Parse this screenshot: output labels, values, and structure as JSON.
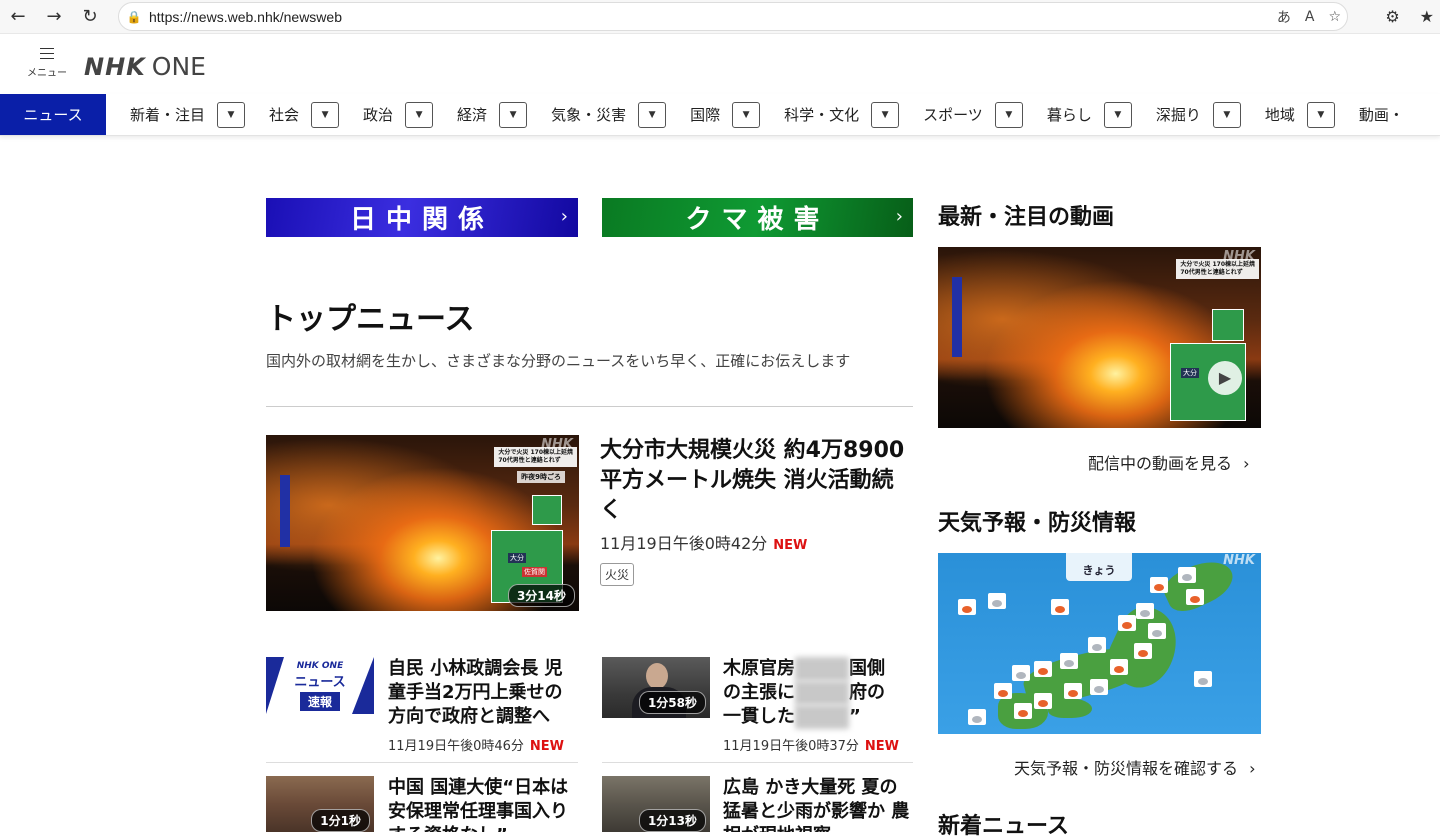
{
  "browser": {
    "url": "https://news.web.nhk/newsweb"
  },
  "header": {
    "menu_label": "メニュー",
    "logo_nhk": "NHK",
    "logo_one": "ONE"
  },
  "nav": {
    "active": "ニュース",
    "items": [
      "新着・注目",
      "社会",
      "政治",
      "経済",
      "気象・災害",
      "国際",
      "科学・文化",
      "スポーツ",
      "暮らし",
      "深掘り",
      "地域",
      "動画・"
    ]
  },
  "banners": {
    "left": "日中関係",
    "right": "クマ被害"
  },
  "top_news": {
    "title": "トップニュース",
    "subtitle": "国内外の取材網を生かし、さまざまな分野のニュースをいち早く、正確にお伝えします"
  },
  "main_article": {
    "headline": "大分市大規模火災 約4万8900平方メートル焼失 消火活動続く",
    "date": "11月19日午後0時42分",
    "new_label": "NEW",
    "tag": "火災",
    "duration": "3分14秒",
    "overlay_nhk": "NHK",
    "overlay_caption_1": "大分で火災 170棟以上延焼",
    "overlay_caption_2": "70代男性と連絡とれず",
    "overlay_caption_3": "昨夜9時ごろ",
    "overlay_place": "大分",
    "overlay_place_2": "佐賀関"
  },
  "articles": [
    {
      "title": "自民 小林政調会長 児童手当2万円上乗せの方向で政府と調整へ",
      "date": "11月19日午後0時46分",
      "new_label": "NEW",
      "thumb_nhk": "NHK ONE",
      "thumb_news": "ニュース",
      "thumb_tag": "速報"
    },
    {
      "title_1": "木原官房",
      "title_2": "国側",
      "title_3": "の主張に",
      "title_4": "府の",
      "title_5": "一貫した",
      "title_6": "”",
      "date": "11月19日午後0時37分",
      "new_label": "NEW",
      "duration": "1分58秒"
    },
    {
      "title": "中国 国連大使“日本は安保理常任理事国入りする資格なし”",
      "duration": "1分1秒"
    },
    {
      "title": "広島 かき大量死 夏の猛暑と少雨が影響か 農相が現地視察",
      "duration": "1分13秒"
    }
  ],
  "sidebar": {
    "video_title": "最新・注目の動画",
    "video_link": "配信中の動画を見る",
    "weather_title": "天気予報・防災情報",
    "weather_link": "天気予報・防災情報を確認する",
    "weather_tab": "きょう",
    "weather_nhk": "NHK",
    "new_news_title": "新着ニュース"
  },
  "colors": {
    "nav_active_bg": "#0a1fa8",
    "banner_left_bg": "#2a1fd0",
    "banner_right_bg": "#0f8a2c",
    "new_badge": "#dd1111"
  }
}
